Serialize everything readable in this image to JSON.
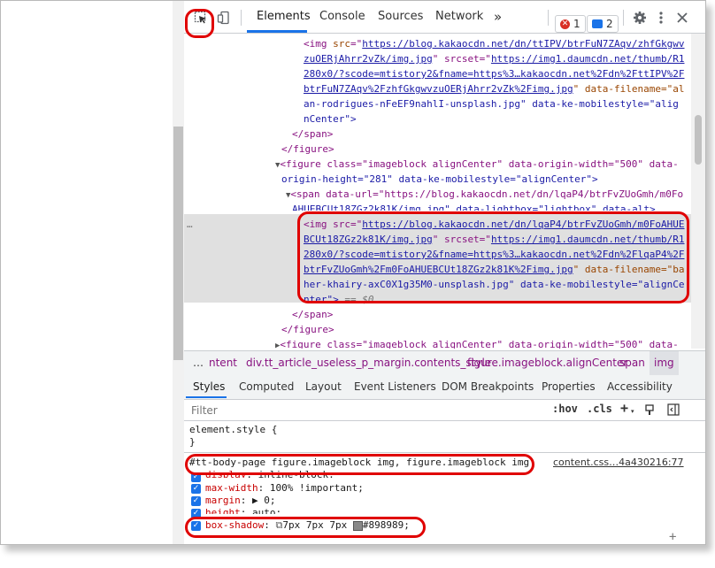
{
  "toolbar": {
    "tabs": [
      {
        "label": "Elements"
      },
      {
        "label": "Console"
      },
      {
        "label": "Sources"
      },
      {
        "label": "Network"
      }
    ],
    "more": "»",
    "error_count": "1",
    "message_count": "2",
    "icons": [
      "inspect-element-icon",
      "device-toggle-icon",
      "settings-gear-icon",
      "more-menu-icon",
      "close-icon"
    ]
  },
  "elements": {
    "lines": {
      "l1": {
        "tag": "<img ",
        "a1": "src",
        "eq": "=\"",
        "link": "https://blog.kakaocdn.net/dn/ttIPV/btrFuN7ZAqv/zhfGkgwv",
        "a2": "srcset",
        "rest": "\" "
      },
      "l2": "zuOERjAhrr2vZk/img.jpg",
      "l2b": "\" srcset=\"",
      "l2c": "https://img1.daumcdn.net/thumb/R1",
      "l3": "280x0/?scode=mtistory2&fname=https%3…kakaocdn.net%2Fdn%2FttIPV%2F",
      "l4": "btrFuN7ZAqv%2FzhfGkgwvzuOERjAhrr2vZk%2Fimg.jpg",
      "l4b": "\" data-filename=\"al",
      "l5": "an-rodrigues-nFeEF9nahlI-unsplash.jpg\" data-ke-mobilestyle=\"alig",
      "l6": "nCenter\">",
      "l7": "</span>",
      "l8": "</figure>",
      "l9": "<figure class=\"imageblock alignCenter\" data-origin-width=\"500\" data-",
      "l10": "origin-height=\"281\" data-ke-mobilestyle=\"alignCenter\">",
      "l11": "<span data-url=\"https://blog.kakaocdn.net/dn/lqaP4/btrFvZUoGmh/m0Fo",
      "l12": "AHUEBCUt18ZGz2k81K/img.jpg\" data-lightbox=\"lightbox\" data-alt>",
      "l13a": "<img src=\"",
      "l13b": "https://blog.kakaocdn.net/dn/lqaP4/btrFvZUoGmh/m0FoAHUE",
      "l14a": "BCUt18ZGz2k81K/img.jpg",
      "l14b": "\" srcset=\"",
      "l14c": "https://img1.daumcdn.net/thumb/R1",
      "l15": "280x0/?scode=mtistory2&fname=https%3…kakaocdn.net%2Fdn%2FlqaP4%2F",
      "l16a": "btrFvZUoGmh%2Fm0FoAHUEBCUt18ZGz2k81K%2Fimg.jpg",
      "l16b": "\" data-filename=\"ba",
      "l17": "her-khairy-axC0X1g35M0-unsplash.jpg\" data-ke-mobilestyle=\"alignCe",
      "l18a": "nter\">",
      "l18b": " == $0",
      "l19": "</span>",
      "l20": "</figure>",
      "l21": "<figure class=\"imageblock alignCenter\" data-origin-width=\"500\" data-"
    },
    "ellipsis": "…"
  },
  "breadcrumb": [
    "…",
    "ntent",
    "div.tt_article_useless_p_margin.contents_style",
    "figure.imageblock.alignCenter",
    "span",
    "img"
  ],
  "subtabs": [
    "Styles",
    "Computed",
    "Layout",
    "Event Listeners",
    "DOM Breakpoints",
    "Properties",
    "Accessibility"
  ],
  "filter": {
    "placeholder": "Filter",
    "hov": ":hov",
    "cls": ".cls",
    "plus": "+"
  },
  "styles": {
    "element_style": "element.style {",
    "close_brace": "}",
    "selector": "#tt-body-page figure.imageblock img, figure.imageblock img",
    "source": "content.css…4a430216:77",
    "props": [
      {
        "name": "display",
        "value": "inline-block;"
      },
      {
        "name": "max-width",
        "value": "100% !important;"
      },
      {
        "name": "margin",
        "value": "▶ 0;"
      },
      {
        "name": "height",
        "value": "auto;"
      }
    ],
    "box_shadow": {
      "name": "box-shadow",
      "value": "7px 7px 7px",
      "color": "#898989",
      "suffix": ";"
    }
  },
  "colors": {
    "accent": "#1a73e8",
    "annotation": "#e00000",
    "tag": "#881280",
    "attr": "#994500",
    "value": "#1a1aa6"
  }
}
